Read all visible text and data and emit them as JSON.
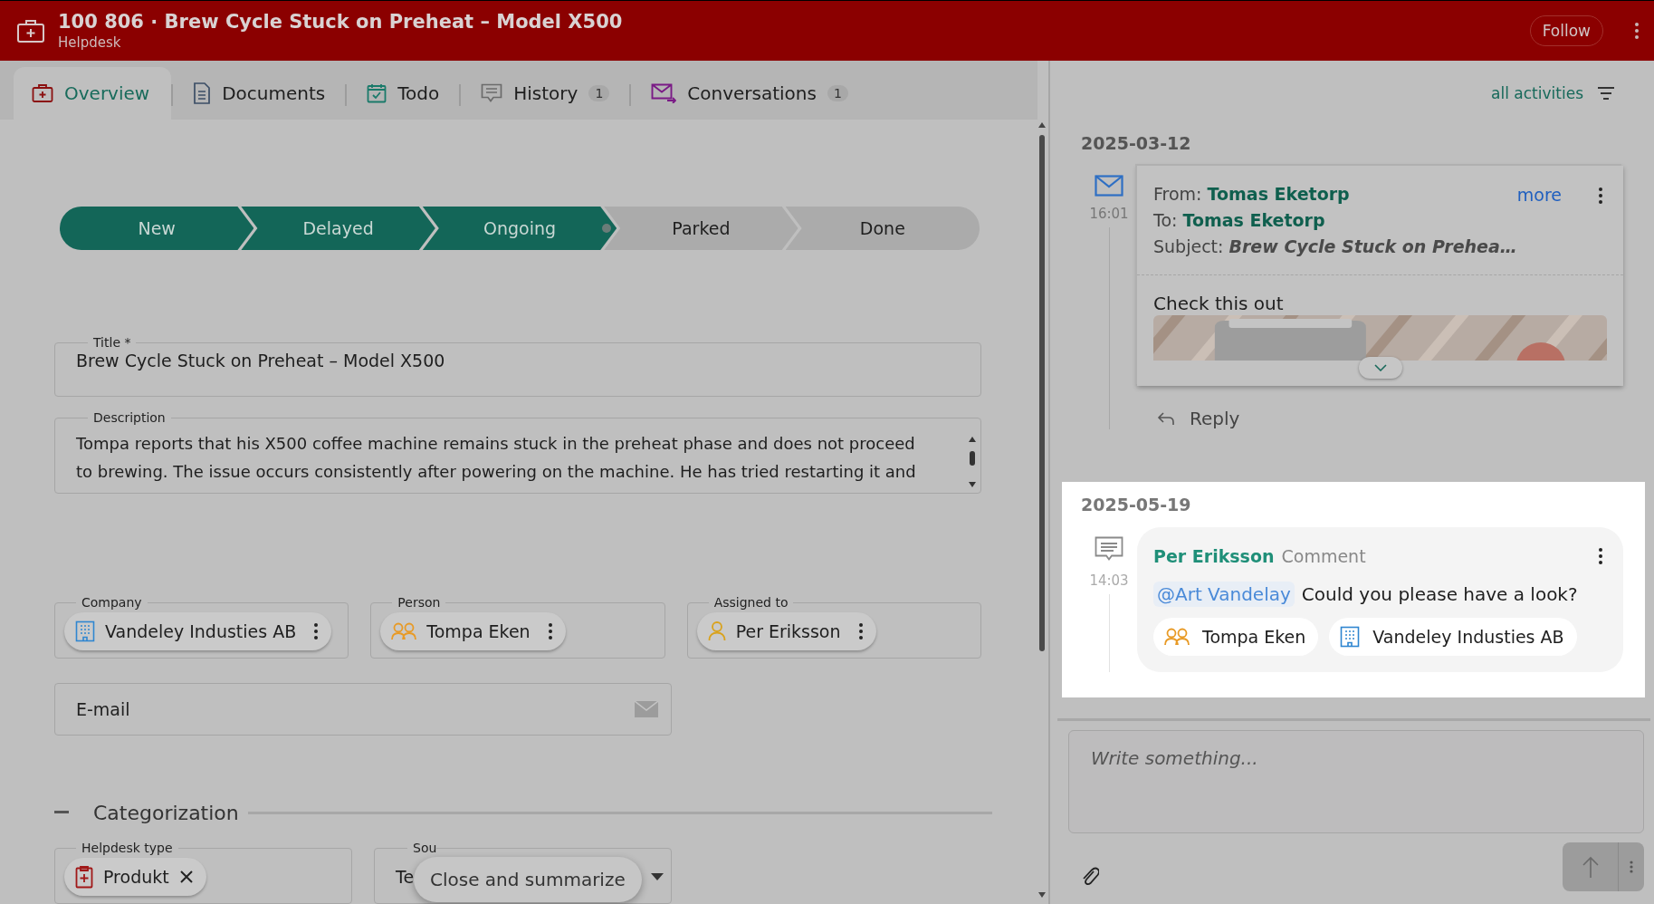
{
  "header": {
    "title": "100 806 · Brew Cycle Stuck on Preheat – Model X500",
    "subtitle": "Helpdesk",
    "follow_button": "Follow"
  },
  "tabs": [
    {
      "label": "Overview",
      "kind": "overview",
      "selected": true
    },
    {
      "label": "Documents",
      "kind": "documents",
      "selected": false
    },
    {
      "label": "Todo",
      "kind": "todo",
      "selected": false
    },
    {
      "label": "History",
      "kind": "history",
      "badge": "1",
      "selected": false
    },
    {
      "label": "Conversations",
      "kind": "conversations",
      "badge": "1",
      "selected": false
    }
  ],
  "stages": [
    {
      "label": "New",
      "completed": true,
      "selected": false
    },
    {
      "label": "Delayed",
      "completed": true,
      "selected": false
    },
    {
      "label": "Ongoing",
      "completed": true,
      "selected": true
    },
    {
      "label": "Parked",
      "completed": false,
      "selected": false
    },
    {
      "label": "Done",
      "completed": false,
      "selected": false
    }
  ],
  "title_field": {
    "label": "Title *",
    "value": "Brew Cycle Stuck on Preheat – Model X500"
  },
  "description_field": {
    "label": "Description",
    "lines": [
      "Tompa reports that his X500 coffee machine remains stuck in the preheat phase and does not proceed",
      "to brewing. The issue occurs consistently after powering on the machine. He has tried restarting it and"
    ]
  },
  "link_fields": [
    {
      "label": "Company",
      "chip": "Vandeley Industies AB",
      "kind": "company"
    },
    {
      "label": "Person",
      "chip": "Tompa Eken",
      "kind": "people"
    },
    {
      "label": "Assigned to",
      "chip": "Per Eriksson",
      "kind": "person"
    }
  ],
  "email_field": {
    "placeholder": "E-mail"
  },
  "categorization": {
    "title": "Categorization",
    "expanded": true
  },
  "helpdesk_type": {
    "label": "Helpdesk type",
    "chip": "Produkt"
  },
  "source": {
    "label": "Sou",
    "value": "Te"
  },
  "close_button": "Close and summarize",
  "activity_filter": "all activities",
  "activities": [
    {
      "kind": "email",
      "date": "2025-03-12",
      "time": "16:01",
      "highlighted": false,
      "from_label": "From:",
      "from": "Tomas Eketorp",
      "to_label": "To:",
      "to": "Tomas Eketorp",
      "subject_label": "Subject:",
      "subject": "Brew Cycle Stuck on Prehea…",
      "more": "more",
      "body": "Check this out",
      "reply": "Reply"
    },
    {
      "kind": "comment",
      "date": "2025-05-19",
      "time": "14:03",
      "highlighted": true,
      "author": "Per Eriksson",
      "type_label": "Comment",
      "mention": "@Art Vandelay",
      "text": "Could you please have a look?",
      "chips": [
        {
          "text": "Tompa Eken",
          "kind": "people"
        },
        {
          "text": "Vandeley Industies AB",
          "kind": "company"
        }
      ]
    }
  ],
  "composer": {
    "placeholder": "Write something..."
  }
}
